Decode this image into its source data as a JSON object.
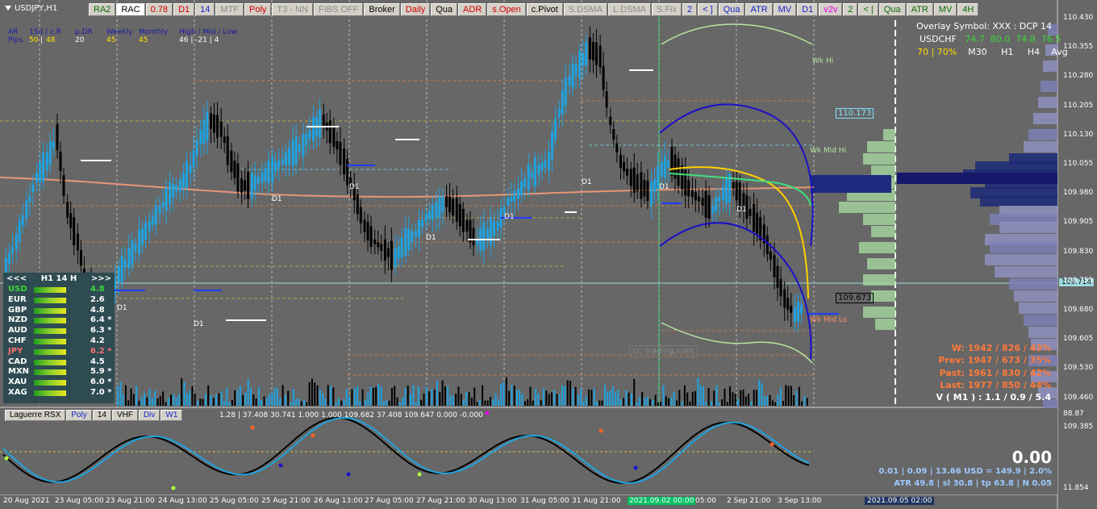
{
  "symbol": "USDJPY,H1",
  "toolbar": [
    "RA2",
    "RAC",
    "0.78",
    "D1",
    "14",
    "MTF",
    "Poly",
    "T3 - NN",
    "FIBS OFF",
    "Broker",
    "Daily",
    "Qua",
    "ADR",
    "s.Open",
    "c.Pivot",
    "S.DSMA",
    "L.DSMA",
    "S.Fix",
    "2",
    "< ]",
    "Qua",
    "ATR",
    "MV",
    "D1",
    "v2v",
    "2",
    "< |",
    "Qua",
    "ATR",
    "MV",
    "4H"
  ],
  "header_stats": {
    "row1": [
      "AR",
      "15d / c.R",
      "p.DR",
      "Weekly",
      "Monthly",
      "High / Mid / Low"
    ],
    "row2_label": "Pips",
    "row2_a": "50",
    "row2_b": "48",
    "row2_pdr": "20",
    "row2_weekly": "45",
    "row2_monthly": "45",
    "row2_hml": "46 | -21 | 4"
  },
  "overlay": {
    "title": "Overlay Symbol: XXX : DCP 14",
    "symbol": "USDCHF",
    "v1": "74.7",
    "v2": "80.0",
    "v3": "74.8",
    "v4": "76.5",
    "pct": "70 | 70%",
    "tf1": "M30",
    "tf2": "H1",
    "tf3": "H4",
    "tf4": "Avg"
  },
  "levels": {
    "wk_hi": "Wk Hi",
    "wk_mid_hi": "Wk Mid Hi",
    "wk_mid_lo": "Wk Mid Lo",
    "box1": "110.173",
    "box2": "109.673",
    "current": "109.714",
    "d1": "D1"
  },
  "price_scale": [
    "110.430",
    "110.355",
    "110.280",
    "110.205",
    "110.130",
    "110.055",
    "109.980",
    "109.905",
    "109.830",
    "109.755",
    "109.680",
    "109.605",
    "109.530",
    "109.460",
    "109.385"
  ],
  "currency_strength": {
    "header_left": "<<<",
    "header_mid": "H1  14  H",
    "header_right": ">>>",
    "rows": [
      {
        "name": "USD",
        "value": "4.8",
        "color": "#3ad83a"
      },
      {
        "name": "EUR",
        "value": "2.6",
        "color": "#ffffff"
      },
      {
        "name": "GBP",
        "value": "4.8",
        "color": "#ffffff"
      },
      {
        "name": "NZD",
        "value": "6.4 *",
        "color": "#ffffff"
      },
      {
        "name": "AUD",
        "value": "6.3 *",
        "color": "#ffffff"
      },
      {
        "name": "CHF",
        "value": "4.2",
        "color": "#ffffff"
      },
      {
        "name": "JPY",
        "value": "6.2 *",
        "color": "#ff7070"
      },
      {
        "name": "CAD",
        "value": "4.5",
        "color": "#ffffff"
      },
      {
        "name": "MXN",
        "value": "5.9 *",
        "color": "#ffffff"
      },
      {
        "name": "XAU",
        "value": "6.0 *",
        "color": "#ffffff"
      },
      {
        "name": "XAG",
        "value": "7.0 *",
        "color": "#ffffff"
      }
    ]
  },
  "stats": {
    "w": "W: 1942 / 826 / 43%",
    "prev": "Prev: 1947 / 673 / 35%",
    "past": "Past: 1961 / 830 / 42%",
    "last": "Last: 1977 / 850 / 44%",
    "vol": "V ( M1 ) : 1.1 / 0.9 / 5.4"
  },
  "watermark": "cc_trading.com",
  "oscillator": {
    "buttons": [
      "Laguerre RSX",
      "Poly",
      "14",
      "VHF",
      "Div",
      "W1"
    ],
    "values": "1.28 | 37.408 30.741 1.000 1.000 109.682 37.408 109.647 0.000 -0.000",
    "scale_top": "88.87",
    "scale_bottom": "11.854",
    "big": "0.00",
    "line1": "0.01  |  0.09  |  13.66 USD = 149.9  |  2.0%",
    "line2": "ATR 49.8  | sl 30.8  |  tp 63.8  |  N 0.05"
  },
  "time_axis": [
    "20 Aug 2021",
    "23 Aug 05:00",
    "23 Aug 21:00",
    "24 Aug 13:00",
    "25 Aug 05:00",
    "25 Aug 21:00",
    "26 Aug 13:00",
    "27 Aug 05:00",
    "27 Aug 21:00",
    "30 Aug 13:00",
    "31 Aug 05:00",
    "31 Aug 21:00",
    "2021.09.02 00:00",
    "05:00",
    "2 Sep 21:00",
    "3 Sep 13:00",
    "2021.09.05 02:00"
  ],
  "colors": {
    "background": "#676767",
    "bull": "#1fa3e0",
    "bear": "#000000",
    "ma": "#e89676",
    "current_line": "#9cd8de",
    "cs_panel": "#2e4b52"
  }
}
